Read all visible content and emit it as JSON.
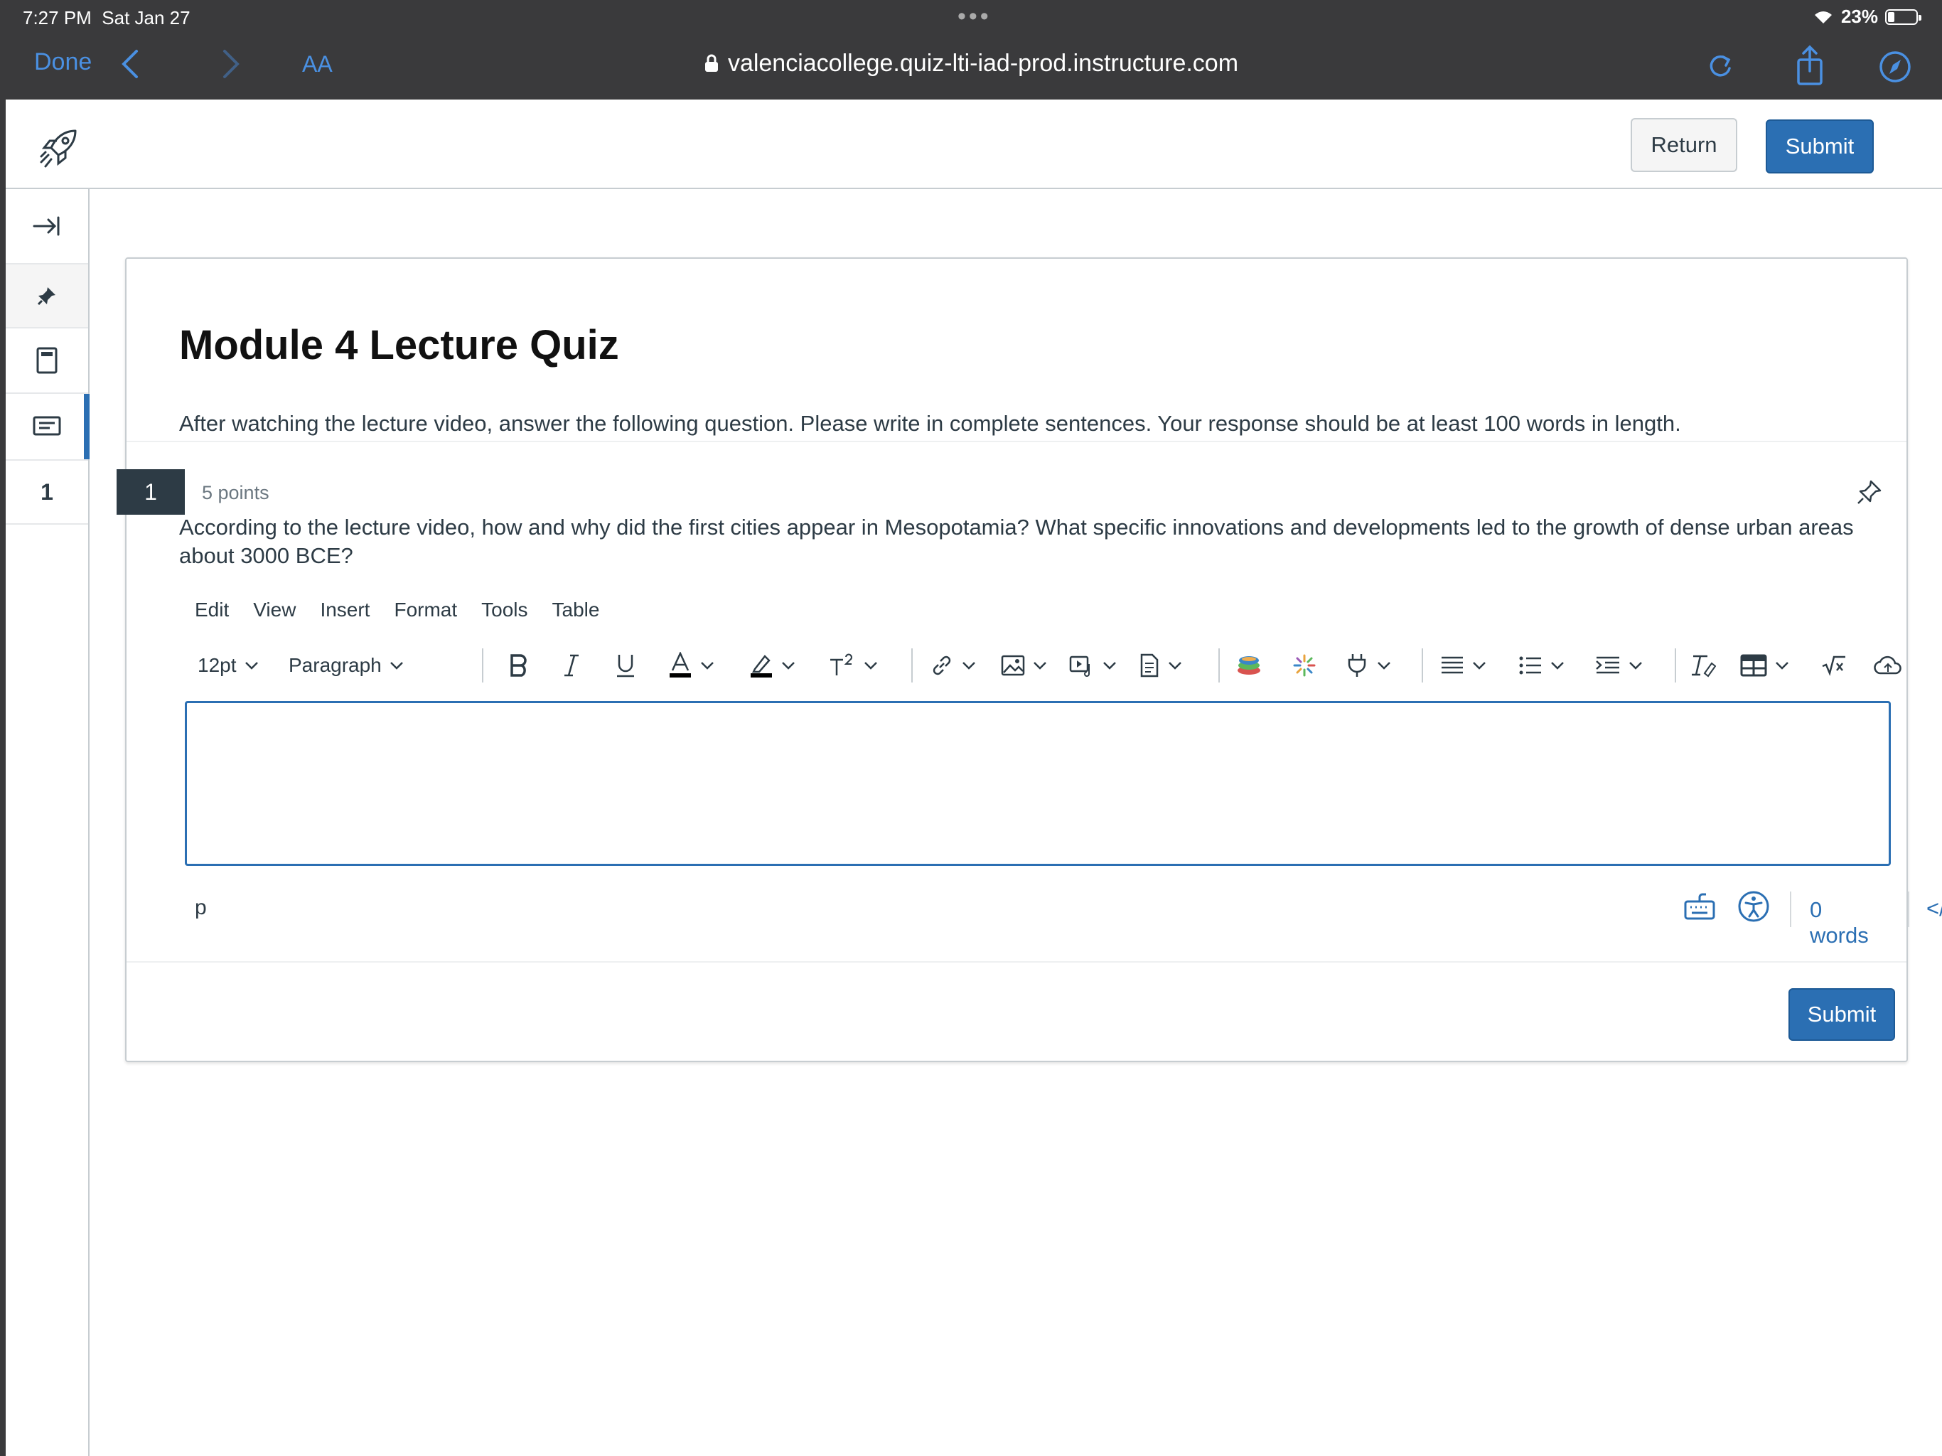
{
  "device": {
    "time": "7:27 PM",
    "date": "Sat Jan 27",
    "battery": "23%",
    "battery_level": 0.23
  },
  "browser": {
    "done_label": "Done",
    "text_size_label": "AA",
    "url": "valenciacollege.quiz-lti-iad-prod.instructure.com"
  },
  "header": {
    "return_label": "Return",
    "submit_label": "Submit"
  },
  "rail": {
    "question_number": "1"
  },
  "quiz": {
    "title": "Module 4 Lecture Quiz",
    "instructions": "After watching the lecture video, answer the following question.  Please write in complete sentences.  Your response should be at least 100 words in length.",
    "question": {
      "number": "1",
      "points": "5 points",
      "text": "According to the lecture video, how and why did the first cities appear in Mesopotamia?  What specific innovations and developments led to the growth of dense urban areas about 3000 BCE?"
    },
    "submit_label": "Submit"
  },
  "editor": {
    "menus": [
      "Edit",
      "View",
      "Insert",
      "Format",
      "Tools",
      "Table"
    ],
    "font_size": "12pt",
    "block_format": "Paragraph",
    "content": "",
    "path": "p",
    "word_count": "0 words",
    "html_toggle": "</>"
  },
  "colors": {
    "accent": "#2b6fb3",
    "chrome_bg": "#3a3a3c",
    "safari_link": "#4a90e2",
    "text": "#2d3b45"
  }
}
